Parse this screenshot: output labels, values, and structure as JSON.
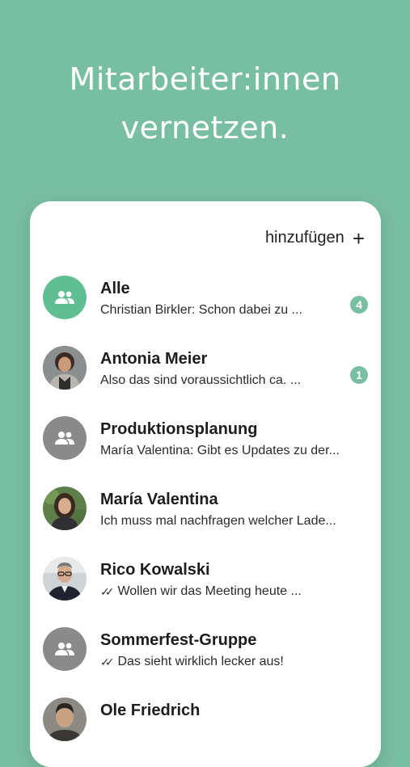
{
  "headline": {
    "line1": "Mitarbeiter:innen",
    "line2": "vernetzen."
  },
  "header": {
    "add_label": "hinzufügen",
    "add_icon": "plus-icon"
  },
  "chats": [
    {
      "name": "Alle",
      "preview": "Christian Birkler: Schon dabei zu ...",
      "badge": "4",
      "avatar": "group-icon",
      "avatar_color": "#5fbf92"
    },
    {
      "name": "Antonia Meier",
      "preview": "Also das sind voraussichtlich ca. ...",
      "badge": "1",
      "avatar": "person-photo"
    },
    {
      "name": "Produktionsplanung",
      "preview": "María Valentina: Gibt es Updates zu der...",
      "avatar": "group-icon",
      "avatar_color": "#8a8a8a"
    },
    {
      "name": "María Valentina",
      "preview": "Ich muss mal nachfragen welcher Lade...",
      "avatar": "person-photo"
    },
    {
      "name": "Rico Kowalski",
      "preview": "Wollen wir das Meeting heute ...",
      "read_icon": "double-check-icon",
      "avatar": "person-photo"
    },
    {
      "name": "Sommerfest-Gruppe",
      "preview": "Das sieht wirklich lecker aus!",
      "read_icon": "double-check-icon",
      "avatar": "group-icon",
      "avatar_color": "#8a8a8a"
    },
    {
      "name": "Ole Friedrich",
      "preview": "",
      "avatar": "person-photo"
    }
  ],
  "colors": {
    "background": "#78bea3",
    "badge": "#78bea3",
    "group_green": "#5fbf92",
    "group_grey": "#8a8a8a"
  }
}
